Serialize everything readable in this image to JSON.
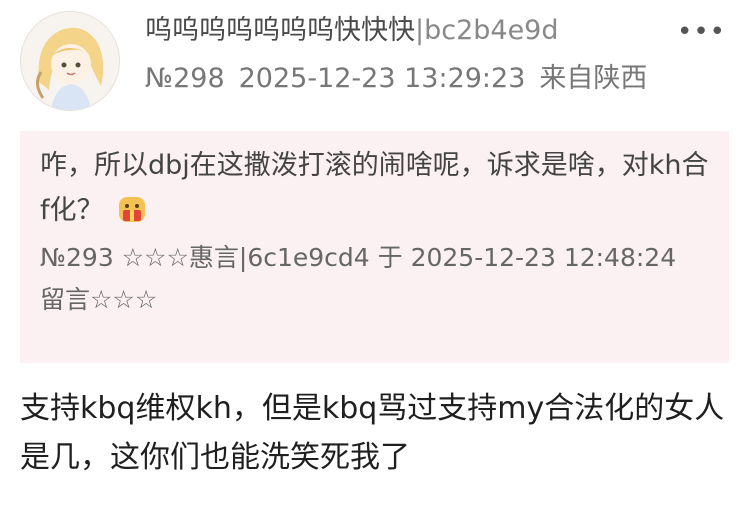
{
  "post": {
    "author_name": "呜呜呜呜呜呜呜快快快",
    "author_hash": "|bc2b4e9d",
    "floor": "№298",
    "datetime": "2025-12-23 13:29:23",
    "location": "来自陕西",
    "more_icon": "more-dots-icon",
    "more_label": "•••"
  },
  "quote": {
    "text": "咋，所以dbj在这撒泼打滚的闹啥呢，诉求是啥，对kh合f化？",
    "emoji_icon": "emoji-gift-icon",
    "meta": "№293 ☆☆☆惠言|6c1e9cd4 于 2025-12-23 12:48:24 留言☆☆☆"
  },
  "reply": {
    "text": "支持kbq维权kh，但是kbq骂过支持my合法化的女人是几，这你们也能洗笑死我了"
  },
  "colors": {
    "quote_background": "#fbf1f3",
    "meta_text": "#777777"
  }
}
